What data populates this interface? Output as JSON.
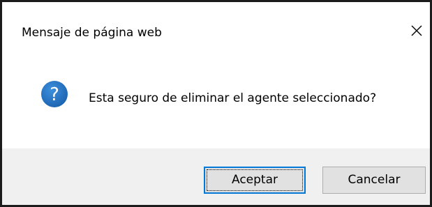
{
  "dialog": {
    "title": "Mensaje de página web",
    "close_icon": "close-icon",
    "message": "Esta seguro de eliminar el agente seleccionado?",
    "message_icon": "question-icon",
    "accent_color": "#0078d7",
    "icon_color": "#1e6fbd",
    "buttons": {
      "accept_label": "Aceptar",
      "cancel_label": "Cancelar"
    }
  }
}
